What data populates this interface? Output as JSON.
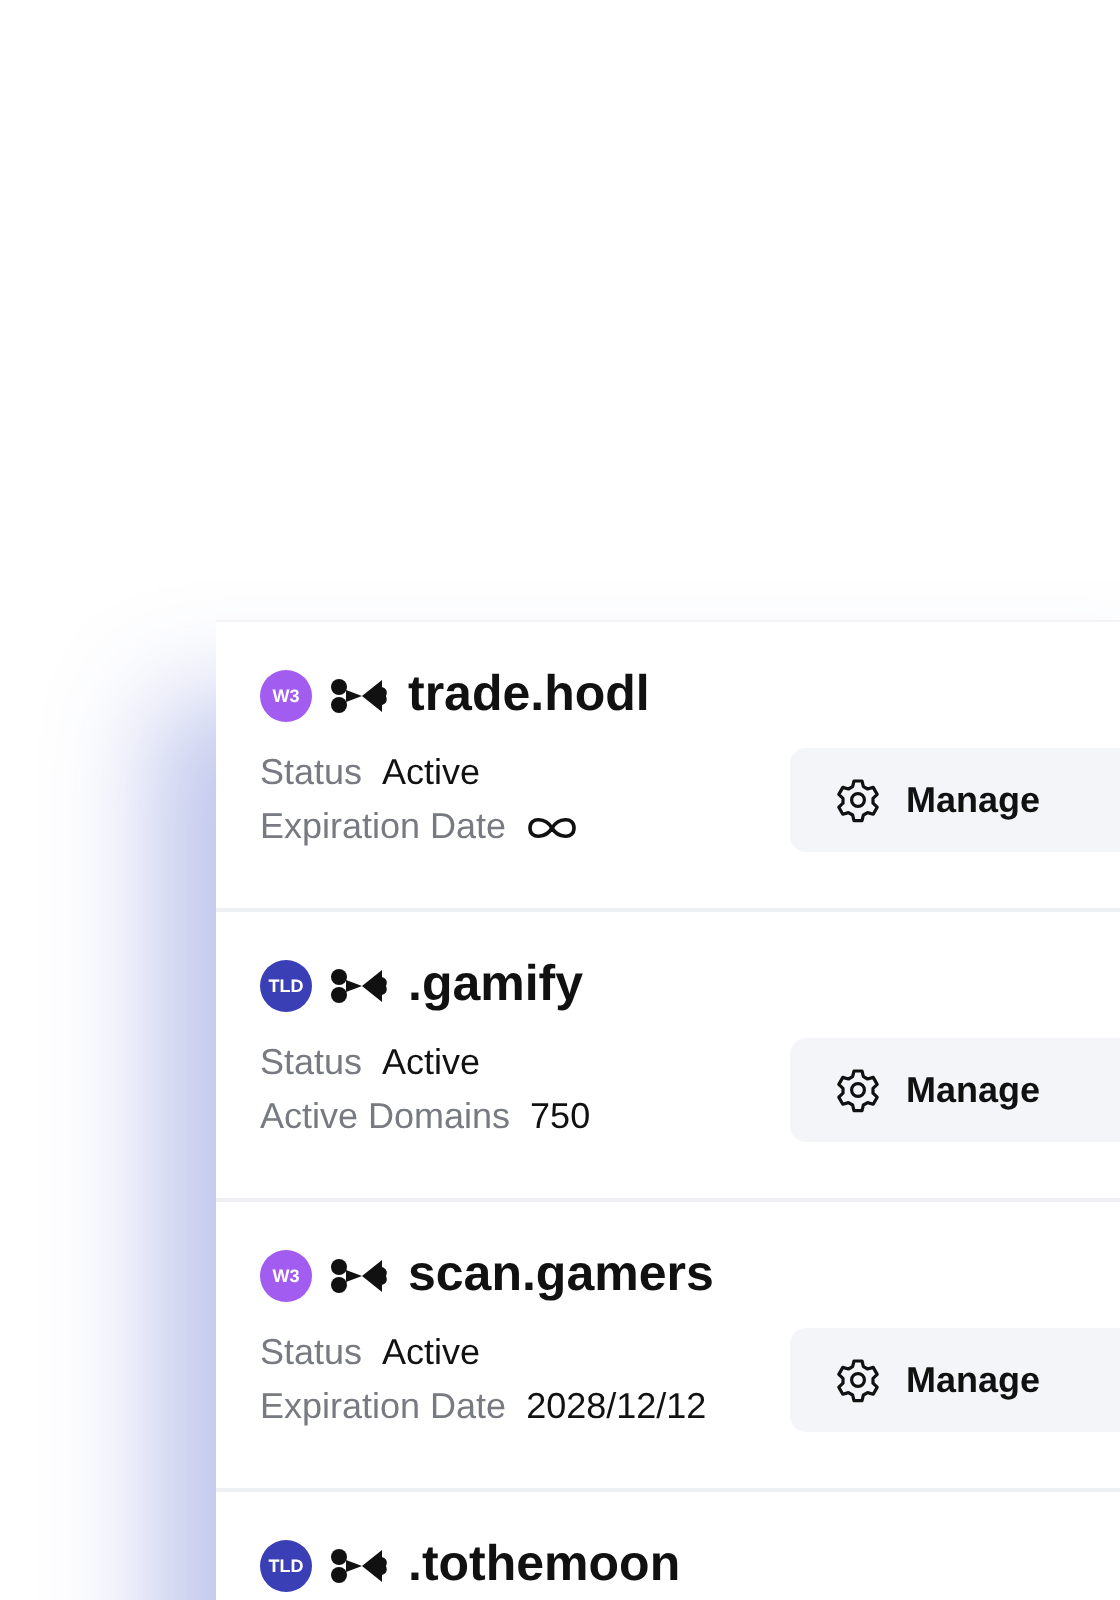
{
  "domains": [
    {
      "badge": "W3",
      "color": "#a35cf0",
      "name": "trade.hodl",
      "details": [
        {
          "label": "Status",
          "kind": "text",
          "value": "Active"
        },
        {
          "label": "Expiration Date",
          "kind": "infinity"
        }
      ],
      "button": "Manage"
    },
    {
      "badge": "TLD",
      "color": "#3a3fb5",
      "name": ".gamify",
      "details": [
        {
          "label": "Status",
          "kind": "text",
          "value": "Active"
        },
        {
          "label": "Active Domains",
          "kind": "text",
          "value": "750"
        }
      ],
      "button": "Manage"
    },
    {
      "badge": "W3",
      "color": "#a35cf0",
      "name": "scan.gamers",
      "details": [
        {
          "label": "Status",
          "kind": "text",
          "value": "Active"
        },
        {
          "label": "Expiration Date",
          "kind": "text",
          "value": "2028/12/12"
        }
      ],
      "button": "Manage"
    },
    {
      "badge": "TLD",
      "color": "#3a3fb5",
      "name": ".tothemoon"
    }
  ]
}
